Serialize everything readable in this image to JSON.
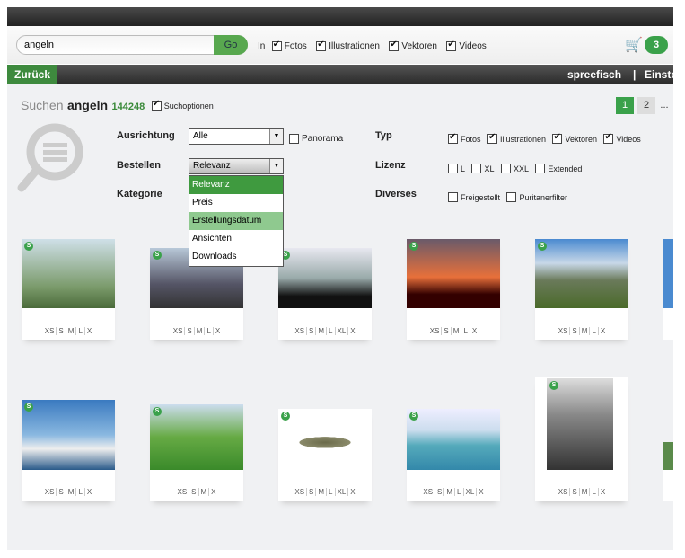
{
  "search": {
    "value": "angeln",
    "go_label": "Go",
    "in_label": "In",
    "filters": [
      {
        "label": "Fotos",
        "checked": true
      },
      {
        "label": "Illustrationen",
        "checked": true
      },
      {
        "label": "Vektoren",
        "checked": true
      },
      {
        "label": "Videos",
        "checked": true
      }
    ]
  },
  "cart": {
    "count": "3"
  },
  "nav": {
    "back_label": "Zurück",
    "user": "spreefisch",
    "separator": "|",
    "settings": "Einste"
  },
  "results": {
    "search_label": "Suchen",
    "query": "angeln",
    "count": "144248",
    "options_label": "Suchoptionen",
    "options_checked": true
  },
  "pagination": {
    "pages": [
      "1",
      "2"
    ],
    "more": "...",
    "current": "1"
  },
  "filters": {
    "ausrichtung": {
      "label": "Ausrichtung",
      "value": "Alle",
      "panorama": "Panorama"
    },
    "bestellen": {
      "label": "Bestellen",
      "value": "Relevanz",
      "options": [
        "Relevanz",
        "Preis",
        "Erstellungsdatum",
        "Ansichten",
        "Downloads"
      ],
      "selected": "Relevanz",
      "hovered": "Erstellungsdatum"
    },
    "kategorie": {
      "label": "Kategorie"
    },
    "typ": {
      "label": "Typ",
      "items": [
        "Fotos",
        "Illustrationen",
        "Vektoren",
        "Videos"
      ]
    },
    "lizenz": {
      "label": "Lizenz",
      "items": [
        "L",
        "XL",
        "XXL",
        "Extended"
      ]
    },
    "diverses": {
      "label": "Diverses",
      "items": [
        "Freigestellt",
        "Puritanerfilter"
      ]
    }
  },
  "colors": {
    "accent": "#3aa14a",
    "dark": "#2a2a2a"
  },
  "badge": "S",
  "images": [
    {
      "sizes": [
        "XS",
        "S",
        "M",
        "L",
        "X"
      ],
      "scene": "angler by river"
    },
    {
      "sizes": [
        "XS",
        "S",
        "M",
        "L",
        "X"
      ],
      "scene": "fishing on boat"
    },
    {
      "sizes": [
        "XS",
        "S",
        "M",
        "L",
        "XL",
        "X"
      ],
      "scene": "pier sunset"
    },
    {
      "sizes": [
        "XS",
        "S",
        "M",
        "L",
        "X"
      ],
      "scene": "angler sunset"
    },
    {
      "sizes": [
        "XS",
        "S",
        "M",
        "L",
        "X"
      ],
      "scene": "fjord huts"
    },
    {
      "sizes": [
        "XS",
        "S",
        "M",
        "L",
        "X"
      ],
      "scene": "fishing boat"
    },
    {
      "sizes": [
        "XS",
        "S",
        "M",
        "X"
      ],
      "scene": "cartoon angler"
    },
    {
      "sizes": [
        "XS",
        "S",
        "M",
        "L",
        "XL",
        "X"
      ],
      "scene": "zander fish"
    },
    {
      "sizes": [
        "XS",
        "S",
        "M",
        "L",
        "XL",
        "X"
      ],
      "scene": "fishing rod sea"
    },
    {
      "sizes": [
        "XS",
        "S",
        "M",
        "L",
        "X"
      ],
      "scene": "wooden jetty"
    }
  ]
}
